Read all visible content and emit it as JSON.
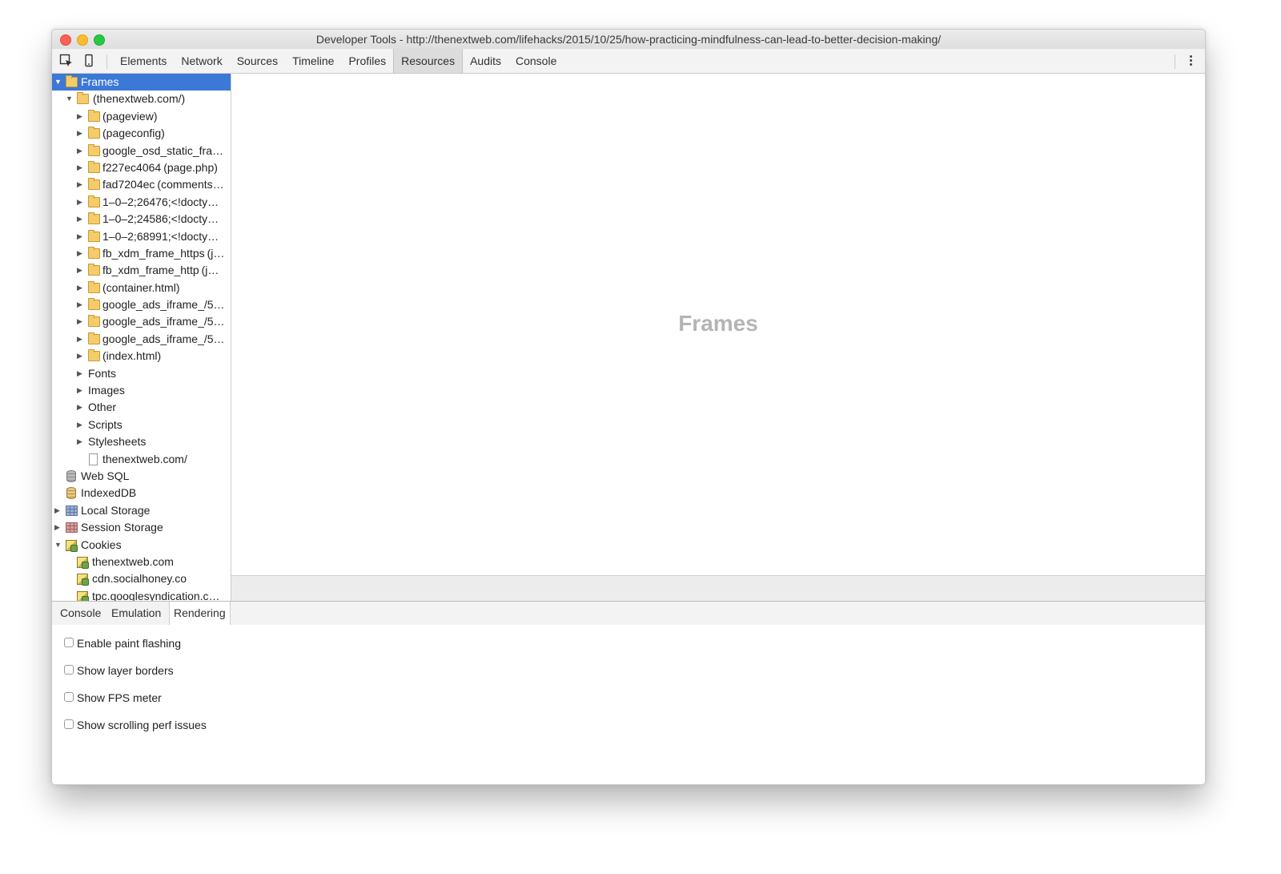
{
  "window": {
    "title": "Developer Tools - http://thenextweb.com/lifehacks/2015/10/25/how-practicing-mindfulness-can-lead-to-better-decision-making/"
  },
  "toolbar": {
    "inspect_icon": "inspect-element-icon",
    "device_icon": "device-mode-icon",
    "tabs": [
      "Elements",
      "Network",
      "Sources",
      "Timeline",
      "Profiles",
      "Resources",
      "Audits",
      "Console"
    ],
    "active_tab": "Resources",
    "menu_icon": "more-vertical-icon"
  },
  "sidebar": {
    "frames_root": "Frames",
    "main_frame": "(thenextweb.com/)",
    "child_frames": [
      {
        "name": "(pageview)"
      },
      {
        "name": "(pageconfig)"
      },
      {
        "name": "google_osd_static_fra…"
      },
      {
        "name": "f227ec4064",
        "detail": "(page.php)"
      },
      {
        "name": "fad7204ec",
        "detail": "(comments…"
      },
      {
        "name": "1–0–2;26476;<!docty…"
      },
      {
        "name": "1–0–2;24586;<!docty…"
      },
      {
        "name": "1–0–2;68991;<!docty…"
      },
      {
        "name": "fb_xdm_frame_https",
        "detail": "(j…"
      },
      {
        "name": "fb_xdm_frame_http",
        "detail": "(j…"
      },
      {
        "name": "(container.html)"
      },
      {
        "name": "google_ads_iframe_/5…"
      },
      {
        "name": "google_ads_iframe_/5…"
      },
      {
        "name": "google_ads_iframe_/5…"
      },
      {
        "name": "(index.html)"
      }
    ],
    "resource_groups": [
      "Fonts",
      "Images",
      "Other",
      "Scripts",
      "Stylesheets"
    ],
    "document": "thenextweb.com/",
    "web_sql": "Web SQL",
    "indexeddb": "IndexedDB",
    "local_storage": "Local Storage",
    "session_storage": "Session Storage",
    "cookies": "Cookies",
    "cookie_domains": [
      "thenextweb.com",
      "cdn.socialhoney.co",
      "tpc.googlesyndication.c…"
    ]
  },
  "main": {
    "title": "Frames"
  },
  "drawer": {
    "tabs": [
      "Console",
      "Emulation",
      "Rendering"
    ],
    "active_tab": "Rendering",
    "options": [
      {
        "label": "Enable paint flashing",
        "checked": false
      },
      {
        "label": "Show layer borders",
        "checked": false
      },
      {
        "label": "Show FPS meter",
        "checked": false
      },
      {
        "label": "Show scrolling perf issues",
        "checked": false
      }
    ]
  },
  "colors": {
    "selection": "#3c78d6",
    "folder": "#f5cc6a",
    "close": "#fc5f57",
    "minimize": "#fdbc2e",
    "zoom": "#28c840"
  }
}
